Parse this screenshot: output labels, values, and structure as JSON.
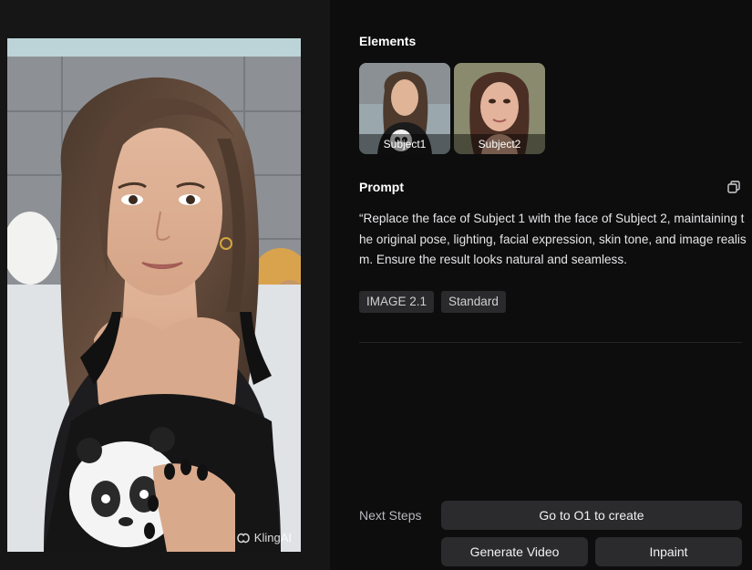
{
  "preview": {
    "watermark": "KlingAI"
  },
  "elements": {
    "title": "Elements",
    "items": [
      {
        "label": "Subject1"
      },
      {
        "label": "Subject2"
      }
    ]
  },
  "prompt": {
    "title": "Prompt",
    "text": "“Replace the face of Subject 1 with the face of Subject 2, maintaining the original pose, lighting, facial expression, skin tone, and image realism. Ensure the result looks natural and seamless."
  },
  "tags": [
    "IMAGE 2.1",
    "Standard"
  ],
  "next_steps": {
    "label": "Next Steps",
    "go_o1": "Go to O1 to create",
    "generate_video": "Generate Video",
    "inpaint": "Inpaint"
  }
}
